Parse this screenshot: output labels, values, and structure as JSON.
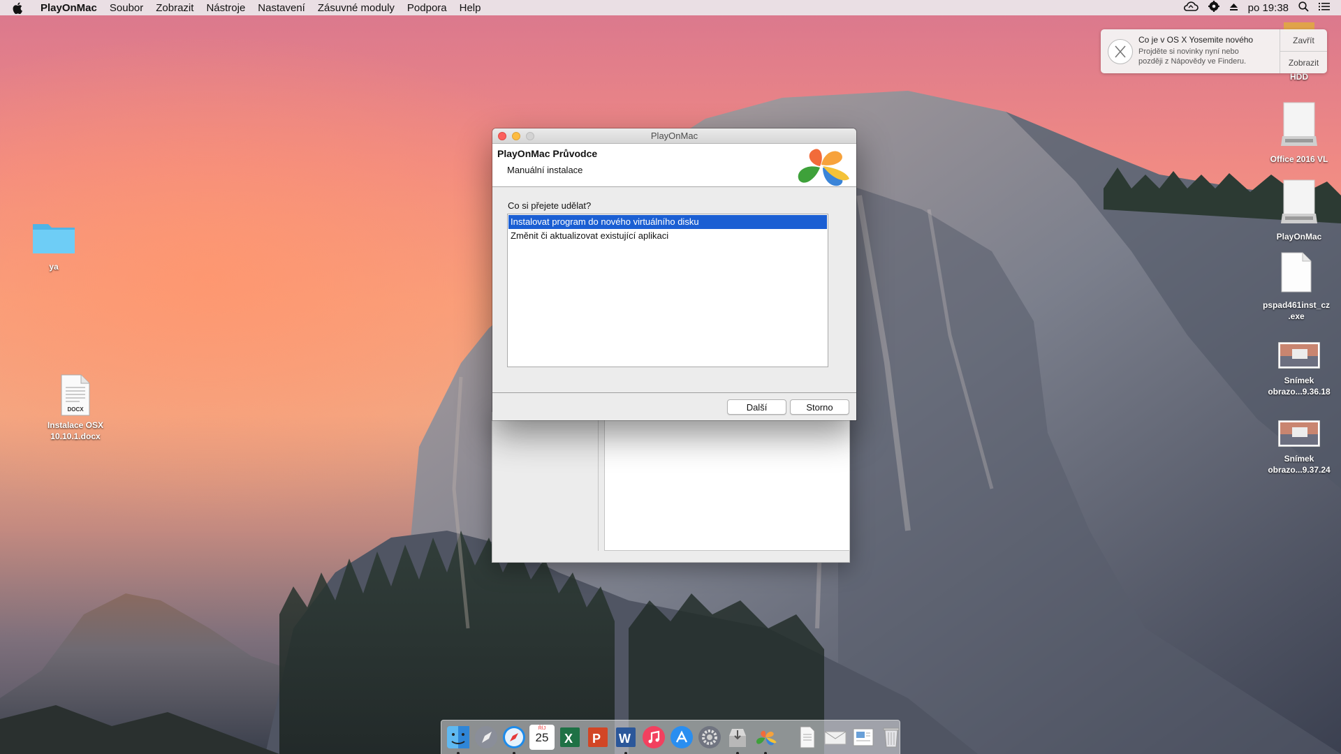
{
  "menubar": {
    "app_name": "PlayOnMac",
    "items": [
      "Soubor",
      "Zobrazit",
      "Nástroje",
      "Nastavení",
      "Zásuvné moduly",
      "Podpora",
      "Help"
    ],
    "clock": "po 19:38",
    "icons": [
      "apple-icon",
      "cloud-icon",
      "gear-icon",
      "eject-icon",
      "search-icon",
      "list-icon"
    ]
  },
  "notification": {
    "title": "Co je v OS X Yosemite nového",
    "body_line1": "Projděte si novinky nyní nebo",
    "body_line2": "později z Nápovědy ve Finderu.",
    "close_button": "Zavřít",
    "show_button": "Zobrazit"
  },
  "desktop_icons": {
    "folder_ya": "ya",
    "docx_line1": "Instalace OSX",
    "docx_line2": "10.10.1.docx",
    "docx_badge": "DOCX",
    "hdd": "HDD",
    "office": "Office 2016 VL",
    "playonmac": "PlayOnMac",
    "pspad_line1": "pspad461inst_cz",
    "pspad_line2": ".exe",
    "snap1_line1": "Snímek",
    "snap1_line2": "obrazo...9.36.18",
    "snap2_line1": "Snímek",
    "snap2_line2": "obrazo...9.37.24"
  },
  "dialog": {
    "window_title": "PlayOnMac",
    "wizard_title": "PlayOnMac Průvodce",
    "wizard_subtitle": "Manuální instalace",
    "question": "Co si přejete udělat?",
    "options": [
      {
        "label": "Instalovat program do nového virtuálního disku",
        "selected": true
      },
      {
        "label": "Změnit či aktualizovat existující aplikaci",
        "selected": false
      }
    ],
    "next_button": "Další",
    "cancel_button": "Storno"
  },
  "dock": {
    "calendar_month": "ŘÍJ",
    "calendar_day": "25",
    "items": [
      "finder-icon",
      "launchpad-icon",
      "safari-icon",
      "calendar-icon",
      "excel-icon",
      "powerpoint-icon",
      "word-icon",
      "itunes-icon",
      "app-store-icon",
      "system-preferences-icon",
      "installer-icon",
      "playonmac-icon",
      "document-icon",
      "mail-icon",
      "preview-icon",
      "trash-icon"
    ]
  }
}
